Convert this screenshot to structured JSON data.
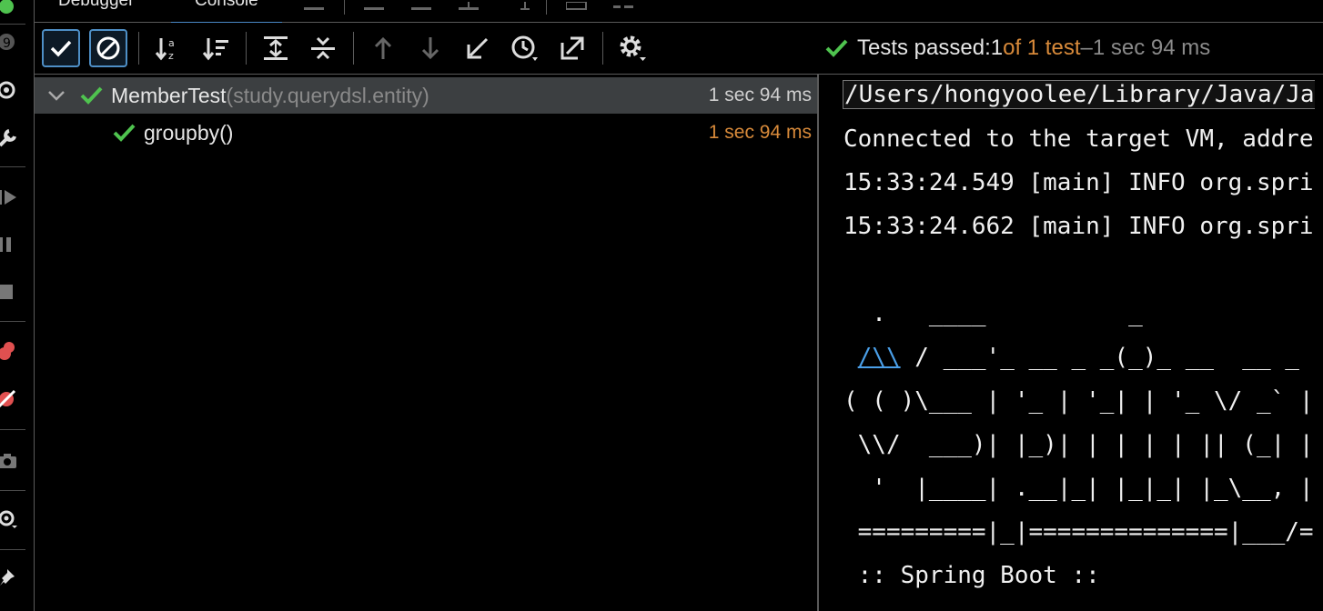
{
  "tabs": [
    {
      "label": "Debugger",
      "active": false
    },
    {
      "label": "Console",
      "active": true
    }
  ],
  "gutter_icons": [
    "bug-icon",
    "debug-circle-icon",
    "settings-gear-icon",
    "wrench-icon",
    "resume-icon",
    "pause-icon",
    "stop-icon",
    "breakpoints-icon",
    "mute-breakpoints-icon",
    "camera-icon",
    "settings-icon",
    "pin-icon"
  ],
  "toolbar": {
    "buttons": [
      "show-passed-icon",
      "show-ignored-icon",
      "sort-alphabetically-icon",
      "sort-by-duration-icon",
      "expand-all-icon",
      "collapse-all-icon",
      "previous-failed-icon",
      "next-failed-icon",
      "import-tests-icon",
      "history-icon",
      "export-icon",
      "settings-gear-icon"
    ]
  },
  "status": {
    "prefix": "Tests passed: ",
    "count": "1",
    "of_text": " of 1 test",
    "separator": " – ",
    "duration": "1 sec 94 ms",
    "accent": "#d88a3a",
    "pass_color": "#4fc34f"
  },
  "tree": {
    "items": [
      {
        "name": "MemberTest",
        "package": " (study.querydsl.entity)",
        "duration": "1 sec 94 ms",
        "selected": true
      },
      {
        "name": "groupby()",
        "duration": "1 sec 94 ms",
        "selected": false
      }
    ]
  },
  "console": {
    "lines": [
      "/Users/hongyoolee/Library/Java/Ja",
      "Connected to the target VM, addre",
      "15:33:24.549 [main] INFO org.spri",
      "15:33:24.662 [main] INFO org.spri",
      "  .   ____          _",
      " /\\\\ / ___'_ __ _ _(_)_ __  __ _",
      "( ( )\\___ | '_ | '_| | '_ \\/ _` |",
      " \\\\/  ___)| |_)| | | | | || (_| |",
      "  '  |____| .__|_| |_|_| |_\\__, |",
      " =========|_|==============|___/=",
      " :: Spring Boot ::"
    ],
    "link_text": "/\\\\"
  }
}
